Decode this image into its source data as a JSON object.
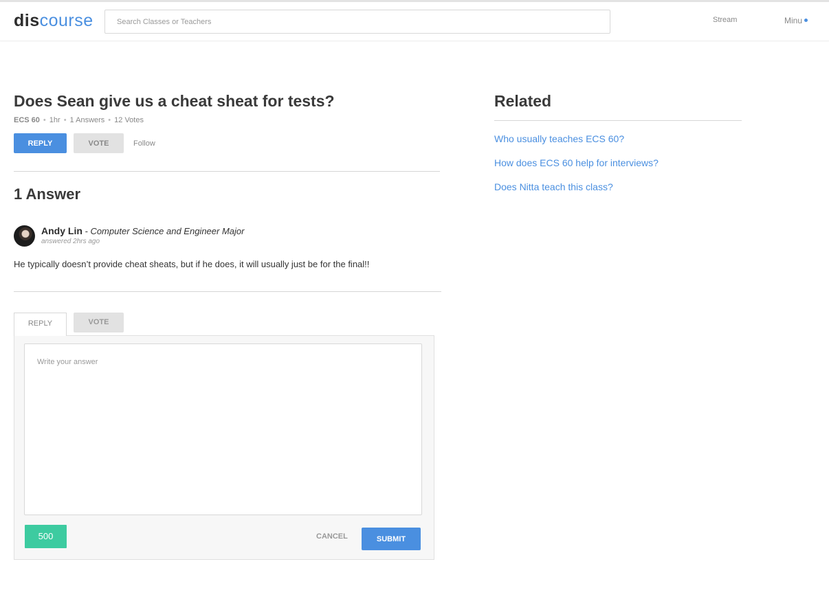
{
  "header": {
    "logo_dis": "dis",
    "logo_course": "course",
    "search_placeholder": "Search Classes or Teachers",
    "nav_stream": "Stream",
    "nav_user": "Minu"
  },
  "question": {
    "title": "Does Sean give us a cheat sheat for tests?",
    "course": "ECS 60",
    "time": "1hr",
    "answers_count": "1 Answers",
    "votes": "12 Votes",
    "reply_label": "REPLY",
    "vote_label": "VOTE",
    "follow_label": "Follow"
  },
  "answers": {
    "heading": "1 Answer",
    "items": [
      {
        "author": "Andy Lin",
        "major": " - Computer Science and Engineer Major",
        "answered": "answered 2hrs ago",
        "body": "He typically doesn’t provide cheat sheats, but if he does, it will usually just be for the final!!"
      }
    ]
  },
  "reply_box": {
    "tab_reply": "REPLY",
    "tab_vote": "VOTE",
    "placeholder": "Write your answer",
    "char_count": "500",
    "cancel_label": "CANCEL",
    "submit_label": "SUBMIT"
  },
  "related": {
    "heading": "Related",
    "items": [
      "Who usually teaches ECS 60?",
      "How does ECS 60 help for interviews?",
      "Does Nitta teach this class?"
    ]
  },
  "colors": {
    "accent": "#4a8fe0",
    "count_badge": "#3dcba0"
  }
}
